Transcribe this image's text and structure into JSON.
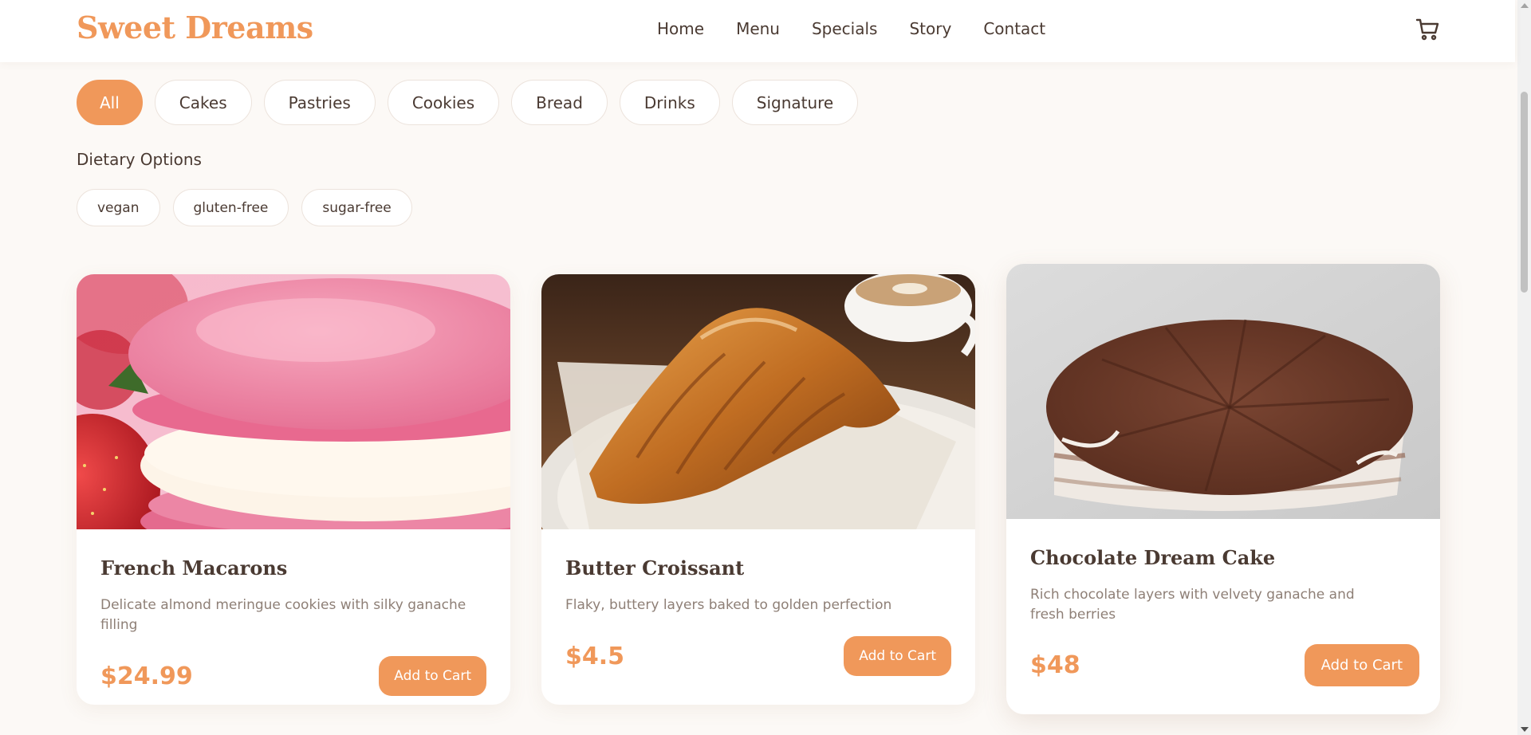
{
  "header": {
    "logo": "Sweet Dreams",
    "nav": [
      "Home",
      "Menu",
      "Specials",
      "Story",
      "Contact"
    ],
    "cart_icon": "shopping-cart-icon"
  },
  "categories": {
    "items": [
      "All",
      "Cakes",
      "Pastries",
      "Cookies",
      "Bread",
      "Drinks",
      "Signature"
    ],
    "active": "All"
  },
  "dietary": {
    "title": "Dietary Options",
    "options": [
      "vegan",
      "gluten-free",
      "sugar-free"
    ]
  },
  "products": [
    {
      "name": "French Macarons",
      "description": "Delicate almond meringue cookies with silky ganache filling",
      "price": "$24.99",
      "button": "Add to Cart",
      "image": "pink-macaron-photo"
    },
    {
      "name": "Butter Croissant",
      "description": "Flaky, buttery layers baked to golden perfection",
      "price": "$4.5",
      "button": "Add to Cart",
      "image": "croissant-and-coffee-photo"
    },
    {
      "name": "Chocolate Dream Cake",
      "description": "Rich chocolate layers with velvety ganache and fresh berries",
      "price": "$48",
      "button": "Add to Cart",
      "image": "chocolate-cake-photo"
    }
  ],
  "colors": {
    "accent": "#f0985a",
    "background": "#fcf9f6",
    "text": "#4a3a32",
    "muted": "#8e7f76"
  }
}
